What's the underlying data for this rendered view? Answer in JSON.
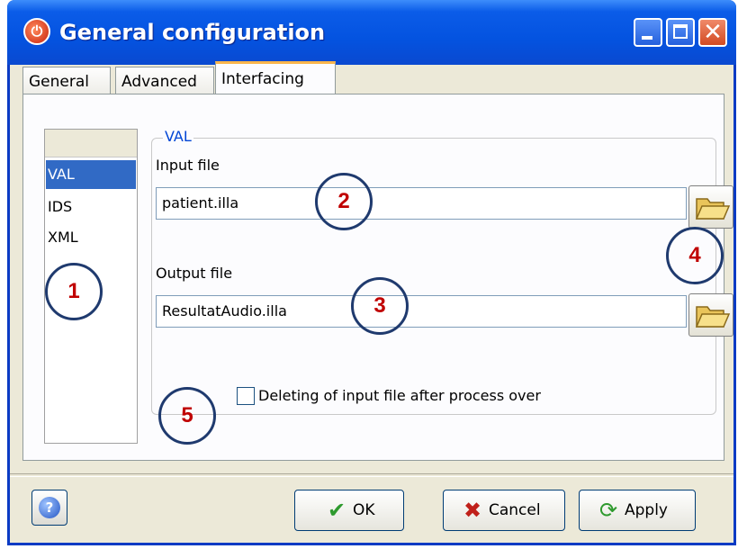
{
  "window": {
    "title": "General configuration",
    "app_icon": "app-logo-icon",
    "controls": {
      "minimize": "minimize-icon",
      "maximize": "maximize-icon",
      "close": "close-icon"
    }
  },
  "tabs": [
    {
      "label": "General",
      "selected": false
    },
    {
      "label": "Advanced",
      "selected": false
    },
    {
      "label": "Interfacing",
      "selected": true
    }
  ],
  "sidebar": {
    "items": [
      {
        "label": "VAL",
        "selected": true
      },
      {
        "label": "IDS",
        "selected": false
      },
      {
        "label": "XML",
        "selected": false
      }
    ]
  },
  "group": {
    "legend": "VAL",
    "input_label": "Input file",
    "input_value": "patient.illa",
    "output_label": "Output file",
    "output_value": "ResultatAudio.illa",
    "checkbox_label": "Deleting of input file after process over",
    "checkbox_checked": false
  },
  "callouts": [
    "1",
    "2",
    "3",
    "4",
    "5"
  ],
  "buttons": {
    "ok": "OK",
    "cancel": "Cancel",
    "apply": "Apply"
  },
  "colors": {
    "title_bar": "#0453e0",
    "selection": "#316ac5",
    "callout_number": "#c00000",
    "callout_ring": "#1f3a6e"
  }
}
